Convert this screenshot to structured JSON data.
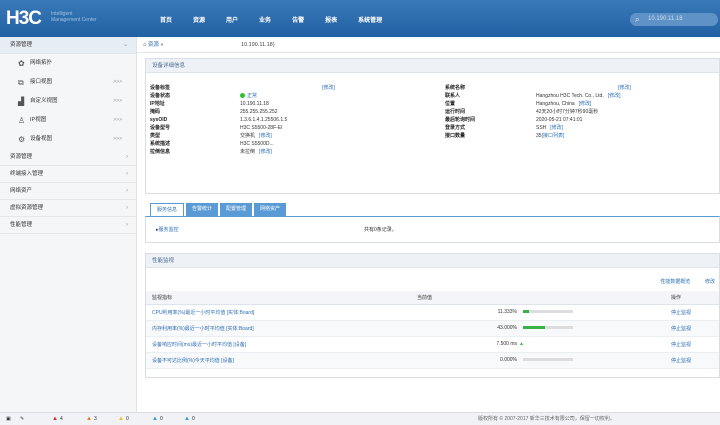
{
  "header": {
    "logo": "H3C",
    "logo_sub_1": "Intelligent",
    "logo_sub_2": "Management Center",
    "nav": [
      "首页",
      "资源",
      "用户",
      "业务",
      "告警",
      "报表",
      "系统管理"
    ],
    "search_value": "10.190.11.18"
  },
  "sidebar": {
    "items": [
      {
        "label": "资源管理",
        "type": "top"
      },
      {
        "label": "网络拓扑",
        "type": "sub",
        "icon": "topology-icon",
        "glyph": "✿",
        "count": ""
      },
      {
        "label": "接口视图",
        "type": "sub",
        "icon": "interface-icon",
        "glyph": "⧉",
        "count": ">>>"
      },
      {
        "label": "自定义视图",
        "type": "sub",
        "icon": "custom-view-icon",
        "glyph": "▟",
        "count": ">>>"
      },
      {
        "label": "IP视图",
        "type": "sub",
        "icon": "ip-view-icon",
        "glyph": "♙",
        "count": ">>>"
      },
      {
        "label": "设备视图",
        "type": "sub",
        "icon": "device-view-icon",
        "glyph": "⚙",
        "count": ">>>"
      },
      {
        "label": "资源管理",
        "type": "group"
      },
      {
        "label": "终端接入管理",
        "type": "group"
      },
      {
        "label": "网络资产",
        "type": "group"
      },
      {
        "label": "虚拟资源管理",
        "type": "group"
      },
      {
        "label": "性能管理",
        "type": "group"
      }
    ]
  },
  "breadcrumb": {
    "home": "资源",
    "sep": "»",
    "ip": "10.190.11.18)"
  },
  "device_panel": {
    "title": "设备详细信息",
    "left": [
      {
        "k": "设备标签",
        "v": "",
        "edit": "[修改]"
      },
      {
        "k": "设备状态",
        "v": "正常",
        "status": true
      },
      {
        "k": "IP地址",
        "v": "10.190.11.18"
      },
      {
        "k": "掩码",
        "v": "255.255.255.252"
      },
      {
        "k": "sysOID",
        "v": "1.3.6.1.4.1.25506.1.5"
      },
      {
        "k": "设备型号",
        "v": "H3C S5500-28F-EI"
      },
      {
        "k": "类型",
        "v": "交换机",
        "edit": "[修改]"
      },
      {
        "k": "系统描述",
        "v": "H3C S5500D..."
      },
      {
        "k": "拉倒信息",
        "v": "未拉倒",
        "edit": "[修改]"
      }
    ],
    "right": [
      {
        "k": "系统名称",
        "v": "",
        "edit": "[修改]"
      },
      {
        "k": "联系人",
        "v": "Hangzhou H3C Tech. Co., Ltd.",
        "edit": "[修改]"
      },
      {
        "k": "位置",
        "v": "Hangzhou, China",
        "edit": "[修改]"
      },
      {
        "k": "运行时间",
        "v": "42天20小时7分钟7秒90毫秒"
      },
      {
        "k": "最后轮询时间",
        "v": "2020-05-21 07:41:01"
      },
      {
        "k": "登录方式",
        "v": "SSH",
        "edit": "[修改]"
      },
      {
        "k": "接口数量",
        "v": "35",
        "link": "[接口列表]"
      }
    ]
  },
  "tabs": [
    "服务信息",
    "告警统计",
    "配置管理",
    "网络资产"
  ],
  "service": {
    "link": "服务监控",
    "empty": "共有0条记录。"
  },
  "perf_panel": {
    "title": "性能监视",
    "actions": [
      "性能数据概览",
      "修改"
    ],
    "columns": [
      "监视指标",
      "当前值",
      "操作"
    ],
    "rows": [
      {
        "metric": "CPU利用率(%)最近一小时平均值 [实体:Board]",
        "value": "11.333%",
        "fill": 0.113,
        "op": "停止监视",
        "trend": ""
      },
      {
        "metric": "内存利用率(%)最近一小时平均值 [实体:Board]",
        "value": "43.000%",
        "fill": 0.43,
        "op": "停止监视",
        "trend": ""
      },
      {
        "metric": "设备响应时间(ms)最近一小时平均值 [设备]",
        "value": "7.500 ms",
        "fill": null,
        "op": "停止监视",
        "trend": "▲"
      },
      {
        "metric": "设备不可达比例(%)今天平均值 [设备]",
        "value": "0.000%",
        "fill": 0.0,
        "op": "停止监视",
        "trend": ""
      }
    ]
  },
  "statusbar": {
    "alarms": [
      {
        "icon": "critical-alarm-icon",
        "color": "#d9302a",
        "count": "4"
      },
      {
        "icon": "major-alarm-icon",
        "color": "#e87a1d",
        "count": "3"
      },
      {
        "icon": "minor-alarm-icon",
        "color": "#e6c21a",
        "count": "0"
      },
      {
        "icon": "warning-alarm-icon",
        "color": "#2f9bd5",
        "count": "0"
      },
      {
        "icon": "info-alarm-icon",
        "color": "#2f9bd5",
        "count": "0"
      }
    ],
    "copyright": "版权所有 © 2007-2017 新华三技术有限公司，保留一切权利。"
  }
}
